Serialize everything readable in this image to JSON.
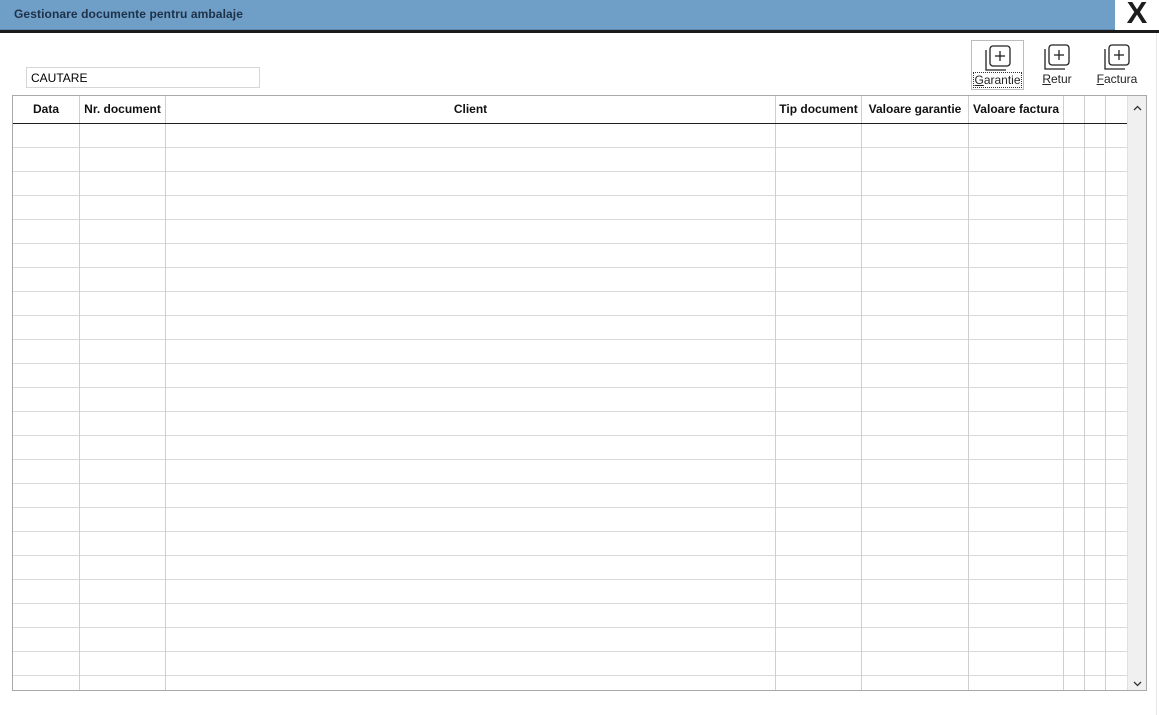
{
  "window": {
    "title": "Gestionare documente pentru ambalaje",
    "close_label": "X",
    "accent_color": "#6f9ec7"
  },
  "search": {
    "value": "CAUTARE"
  },
  "toolbar": {
    "garantie_label": "Garantie",
    "retur_label": "Retur",
    "factura_label": "Factura",
    "icon": "add-document-icon"
  },
  "grid": {
    "columns": [
      "Data",
      "Nr. document",
      "Client",
      "Tip document",
      "Valoare garantie",
      "Valoare factura",
      "",
      ""
    ],
    "rows": []
  }
}
